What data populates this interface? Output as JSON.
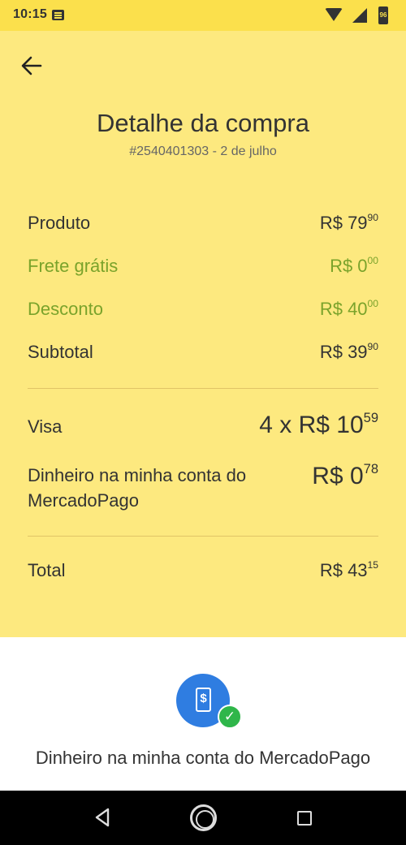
{
  "status_bar": {
    "time": "10:15",
    "battery": "96",
    "icons": [
      "message-icon",
      "wifi-icon",
      "signal-icon",
      "battery-icon"
    ]
  },
  "header": {
    "back_icon": "arrow-left-icon",
    "title": "Detalhe da compra",
    "subtitle": "#2540401303 - 2 de julho"
  },
  "summary": {
    "produto": {
      "label": "Produto",
      "currency": "R$ 79",
      "cents": "90"
    },
    "frete": {
      "label": "Frete grátis",
      "currency": "R$ 0",
      "cents": "00"
    },
    "desconto": {
      "label": "Desconto",
      "currency": "R$ 40",
      "cents": "00"
    },
    "subtotal": {
      "label": "Subtotal",
      "currency": "R$ 39",
      "cents": "90"
    }
  },
  "payment": {
    "visa": {
      "label": "Visa",
      "currency": "4 x R$ 10",
      "cents": "59"
    },
    "account": {
      "label": "Dinheiro na minha conta do MercadoPago",
      "currency": "R$ 0",
      "cents": "78"
    }
  },
  "total": {
    "label": "Total",
    "currency": "R$ 43",
    "cents": "15"
  },
  "payment_method": {
    "icon": "phone-dollar-icon",
    "badge": "check-icon",
    "phone_symbol": "$",
    "check_symbol": "✓",
    "label": "Dinheiro na minha conta do MercadoPago"
  },
  "nav_bar": {
    "buttons": [
      "back-triangle-icon",
      "home-circle-icon",
      "recent-apps-square-icon"
    ]
  },
  "colors": {
    "header_yellow": "#fbe04c",
    "panel_yellow": "#fde97f",
    "green_text": "#7aa32b",
    "method_blue": "#2f7de1",
    "check_green": "#2fb64a"
  }
}
